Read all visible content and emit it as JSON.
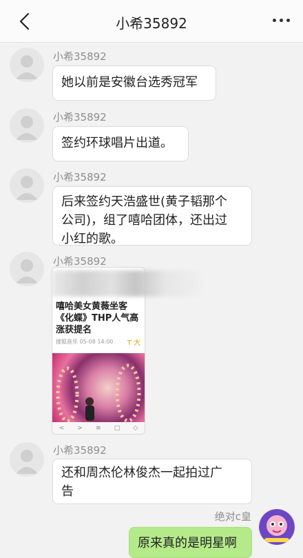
{
  "header": {
    "title": "小希35892"
  },
  "messages": [
    {
      "sender": "小希35892",
      "text": "她以前是安徽台选秀冠军"
    },
    {
      "sender": "小希35892",
      "text": "签约环球唱片出道。"
    },
    {
      "sender": "小希35892",
      "line1": "后来签约天浩盛世(黄子韬那个",
      "line2": "公司)，组了嘻哈团体，还出过",
      "line3": "小红的歌。"
    },
    {
      "sender": "小希35892",
      "image": {
        "headline": "嘻哈美女黄薇坐客《化蝶》THP人气高涨获提名",
        "meta": "搜狐音乐  05-08 14:00",
        "badge": "T",
        "badge_text": "大",
        "nav": [
          "<",
          ">",
          "≡",
          "□",
          "◇"
        ]
      }
    },
    {
      "sender": "小希35892",
      "line1": "还和周杰伦林俊杰一起拍过广",
      "line2": "告"
    }
  ],
  "me": {
    "name": "绝对c皇",
    "text": "原来真的是明星啊"
  },
  "icons": {
    "back": "chevron-left-icon",
    "more": "more-dots-icon"
  },
  "colors": {
    "my_bubble": "#b5ea8a",
    "background": "#f2f2f2"
  }
}
